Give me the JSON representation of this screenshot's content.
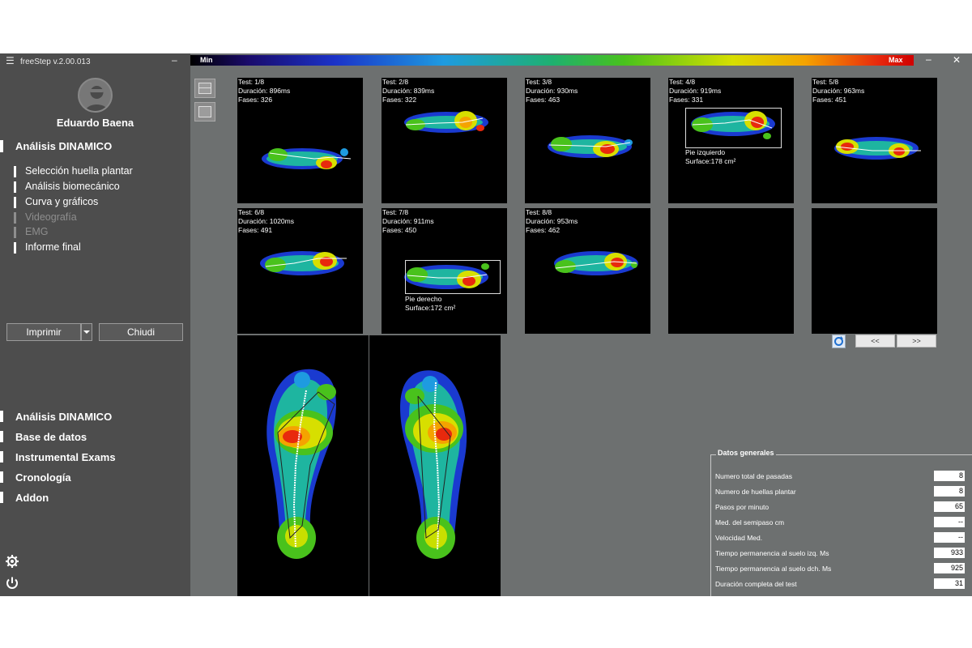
{
  "app": {
    "title": "freeStep v.2.00.013",
    "menu_icon": "hamburger-icon",
    "minimize": "–"
  },
  "user": {
    "name": "Eduardo Baena",
    "avatar_icon": "user-avatar-icon"
  },
  "analysis_section": {
    "title": "Análisis DINAMICO",
    "items": [
      {
        "label": "Selección huella plantar",
        "enabled": true
      },
      {
        "label": "Análisis biomecánico",
        "enabled": true
      },
      {
        "label": "Curva y gráficos",
        "enabled": true
      },
      {
        "label": "Videografía",
        "enabled": false
      },
      {
        "label": "EMG",
        "enabled": false
      },
      {
        "label": "Informe final",
        "enabled": true
      }
    ]
  },
  "actions": {
    "print_label": "Imprimir",
    "close_label": "Chiudi"
  },
  "nav": [
    {
      "label": "Análisis DINAMICO"
    },
    {
      "label": "Base de datos"
    },
    {
      "label": "Instrumental Exams"
    },
    {
      "label": "Cronología"
    },
    {
      "label": "Addon"
    }
  ],
  "scale": {
    "min_label": "Min",
    "max_label": "Max"
  },
  "window": {
    "minimize": "–",
    "close": "✕"
  },
  "tests": [
    {
      "test": "Test: 1/8",
      "duracion": "Duración: 896ms",
      "fases": "Fases: 326"
    },
    {
      "test": "Test: 2/8",
      "duracion": "Duración: 839ms",
      "fases": "Fases: 322"
    },
    {
      "test": "Test: 3/8",
      "duracion": "Duración: 930ms",
      "fases": "Fases: 463"
    },
    {
      "test": "Test: 4/8",
      "duracion": "Duración: 919ms",
      "fases": "Fases: 331",
      "selection": {
        "pie": "Pie izquierdo",
        "surface": "Surface:178 cm²"
      }
    },
    {
      "test": "Test: 5/8",
      "duracion": "Duración: 963ms",
      "fases": "Fases: 451"
    },
    {
      "test": "Test: 6/8",
      "duracion": "Duración: 1020ms",
      "fases": "Fases: 491"
    },
    {
      "test": "Test: 7/8",
      "duracion": "Duración: 911ms",
      "fases": "Fases: 450",
      "selection": {
        "pie": "Pie derecho",
        "surface": "Surface:172 cm²"
      }
    },
    {
      "test": "Test: 8/8",
      "duracion": "Duración: 953ms",
      "fases": "Fases: 462"
    }
  ],
  "pager": {
    "prev": "<<",
    "next": ">>"
  },
  "datos_generales": {
    "title": "Datos generales",
    "rows": [
      {
        "label": "Numero total de pasadas",
        "value": "8"
      },
      {
        "label": "Numero de huellas plantar",
        "value": "8"
      },
      {
        "label": "Pasos por minuto",
        "value": "65"
      },
      {
        "label": "Med. del semipaso cm",
        "value": "--"
      },
      {
        "label": "Velocidad Med.",
        "value": "--"
      },
      {
        "label": "Tiempo permanencia al suelo izq. Ms",
        "value": "933"
      },
      {
        "label": "Tiempo permanencia al suelo dch. Ms",
        "value": "925"
      },
      {
        "label": "Duración completa del test",
        "value": "31"
      }
    ]
  }
}
